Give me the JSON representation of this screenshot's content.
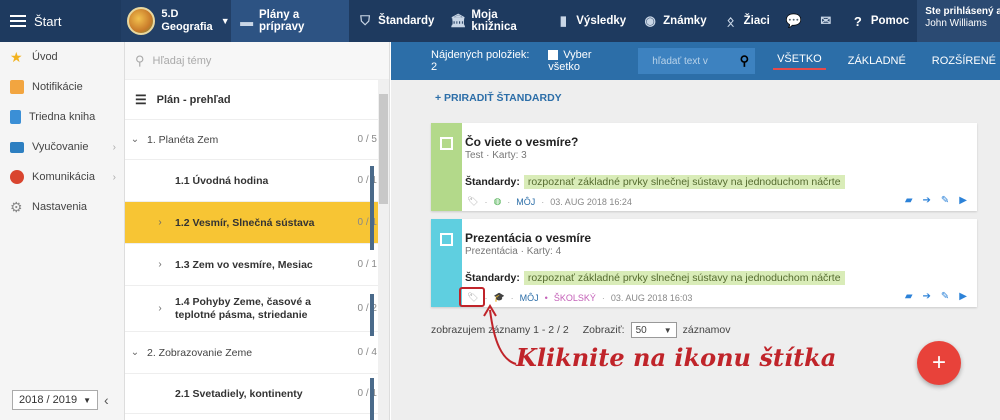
{
  "topbar": {
    "start_label": "Štart",
    "class_code": "5.D",
    "class_subject": "Geografia",
    "nav": [
      {
        "label": "Plány a prípravy",
        "icon": "plans-icon",
        "active": true
      },
      {
        "label": "Štandardy",
        "icon": "shield-icon",
        "active": false
      },
      {
        "label": "Moja knižnica",
        "icon": "library-icon",
        "active": false
      },
      {
        "label": "Výsledky",
        "icon": "bar-chart-icon",
        "active": false
      },
      {
        "label": "Známky",
        "icon": "grades-icon",
        "active": false
      },
      {
        "label": "Žiaci",
        "icon": "students-icon",
        "active": false
      }
    ],
    "help_label": "Pomoc",
    "user_status": "Ste prihlásený ako",
    "user_name": "John Williams"
  },
  "sidebar": {
    "items": [
      {
        "label": "Úvod",
        "icon": "star-icon"
      },
      {
        "label": "Notifikácie",
        "icon": "envelope-icon"
      },
      {
        "label": "Triedna kniha",
        "icon": "book-icon"
      },
      {
        "label": "Vyučovanie",
        "icon": "open-book-icon"
      },
      {
        "label": "Komunikácia",
        "icon": "chat-icon"
      },
      {
        "label": "Nastavenia",
        "icon": "gear-icon"
      }
    ],
    "year": "2018 / 2019"
  },
  "tree": {
    "search_placeholder": "Hľadaj témy",
    "plan_title": "Plán - prehľad",
    "rows": [
      {
        "label": "1. Planéta Zem",
        "count": "0 / 5"
      },
      {
        "label": "1.1 Úvodná hodina",
        "count": "0 / 1"
      },
      {
        "label": "1.2 Vesmír, Slnečná sústava",
        "count": "0 / 1"
      },
      {
        "label": "1.3 Zem vo vesmíre, Mesiac",
        "count": "0 / 1"
      },
      {
        "label": "1.4 Pohyby Zeme, časové a teplotné pásma, striedanie",
        "count": "0 / 2"
      },
      {
        "label": "2. Zobrazovanie Zeme",
        "count": "0 / 4"
      },
      {
        "label": "2.1 Svetadiely, kontinenty",
        "count": "0 / 1"
      }
    ]
  },
  "filter": {
    "found": "Nájdených položiek: 2",
    "select_all": "Vyber všetko",
    "search_placeholder": "hľadať text v",
    "tabs": [
      "VŠETKO",
      "ZÁKLADNÉ",
      "ROZŠÍRENÉ"
    ]
  },
  "assign_label": "+ PRIRADIŤ ŠTANDARDY",
  "cards": [
    {
      "title": "Čo viete o vesmíre?",
      "subtitle": "Test · Karty: 3",
      "std_label": "Štandardy:",
      "standard": "rozpoznať základné prvky slnečnej sústavy na jednoduchom náčrte",
      "owner": "MÔJ",
      "scope": "",
      "date": "03. AUG 2018 16:24",
      "stripe_color": "#b3d98a"
    },
    {
      "title": "Prezentácia o vesmíre",
      "subtitle": "Prezentácia · Karty: 4",
      "std_label": "Štandardy:",
      "standard": "rozpoznať základné prvky slnečnej sústavy na jednoduchom náčrte",
      "owner": "MÔJ",
      "scope": "ŠKOLSKÝ",
      "date": "03. AUG 2018 16:03",
      "stripe_color": "#5fcfe0"
    }
  ],
  "pager": {
    "showing": "zobrazujem záznamy 1 - 2 / 2",
    "show_label": "Zobraziť:",
    "page_size": "50",
    "records_label": "záznamov"
  },
  "callout_text": "Kliknite na ikonu štítka",
  "fab_label": "+"
}
